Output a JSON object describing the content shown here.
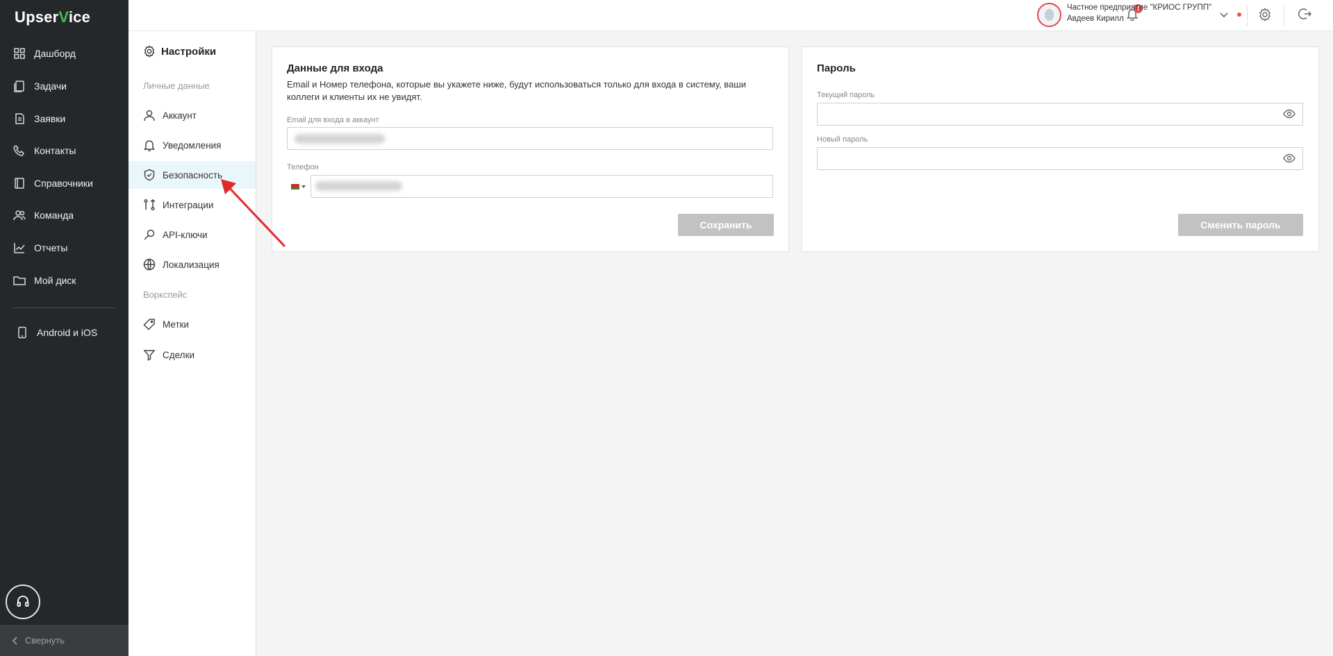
{
  "app": {
    "logo_prefix": "Upser",
    "logo_accent": "V",
    "logo_suffix": "ice",
    "accent_color": "#3fbf5b"
  },
  "nav": {
    "items": [
      {
        "label": "Дашборд",
        "icon": "dashboard-icon"
      },
      {
        "label": "Задачи",
        "icon": "tasks-icon"
      },
      {
        "label": "Заявки",
        "icon": "requests-icon"
      },
      {
        "label": "Контакты",
        "icon": "contacts-icon"
      },
      {
        "label": "Справочники",
        "icon": "reference-icon"
      },
      {
        "label": "Команда",
        "icon": "team-icon"
      },
      {
        "label": "Отчеты",
        "icon": "reports-icon"
      },
      {
        "label": "Мой диск",
        "icon": "folder-icon"
      },
      {
        "label": "Android и iOS",
        "icon": "phone-icon"
      }
    ],
    "collapse_label": "Свернуть"
  },
  "topbar": {
    "notifications_count": "4",
    "company_name": "Частное предприятие \"КРИОС ГРУПП\"",
    "user_name": "Авдеев Кирилл"
  },
  "settings": {
    "title": "Настройки",
    "group_personal": "Личные данные",
    "group_workspace": "Воркспейс",
    "items": [
      {
        "label": "Аккаунт",
        "icon": "user-icon"
      },
      {
        "label": "Уведомления",
        "icon": "bell-icon"
      },
      {
        "label": "Безопасность",
        "icon": "shield-icon",
        "active": true
      },
      {
        "label": "Интеграции",
        "icon": "integration-icon"
      },
      {
        "label": "API-ключи",
        "icon": "key-icon"
      },
      {
        "label": "Локализация",
        "icon": "globe-icon"
      },
      {
        "label": "Метки",
        "icon": "tag-icon"
      },
      {
        "label": "Сделки",
        "icon": "funnel-icon"
      }
    ]
  },
  "login_card": {
    "title": "Данные для входа",
    "description": "Email и Номер телефона, которые вы укажете ниже, будут использоваться только для входа в систему, ваши коллеги и клиенты их не увидят.",
    "email_label": "Email для входа в аккаунт",
    "phone_label": "Телефон",
    "save_label": "Сохранить"
  },
  "password_card": {
    "title": "Пароль",
    "current_label": "Текущий пароль",
    "new_label": "Новый пароль",
    "change_label": "Сменить пароль"
  }
}
